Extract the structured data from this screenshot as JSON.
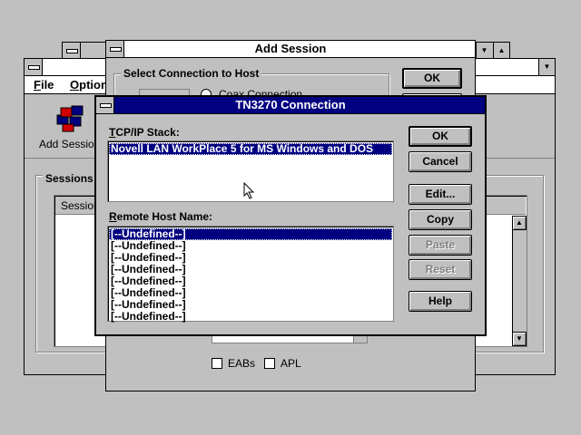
{
  "app_window": {
    "menu": [
      {
        "label": "File",
        "mnemonic": "F",
        "rest": "ile"
      },
      {
        "label": "Option",
        "mnemonic": "O",
        "rest": "ption"
      }
    ],
    "toolbar": {
      "add_session_label": "Add Session"
    },
    "sessions_group_label": "Sessions",
    "sessions_column_header": "Session"
  },
  "add_session_dialog": {
    "title": "Add Session",
    "group_label": "Select Connection to Host",
    "radio_label": "Coax Connection",
    "ok_label": "OK",
    "eabs_label": "EABs",
    "apl_label": "APL"
  },
  "tn3270_dialog": {
    "title": "TN3270 Connection",
    "tcpip_label": "TCP/IP Stack:",
    "tcpip_mnemonic": "T",
    "tcpip_rest": "CP/IP Stack:",
    "tcpip_items": [
      "Novell LAN WorkPlace 5 for MS Windows and DOS"
    ],
    "remote_host_label": "Remote Host Name:",
    "remote_host_mnemonic": "R",
    "remote_host_rest": "emote Host Name:",
    "remote_host_items": [
      "[--Undefined--]",
      "[--Undefined--]",
      "[--Undefined--]",
      "[--Undefined--]",
      "[--Undefined--]",
      "[--Undefined--]",
      "[--Undefined--]",
      "[--Undefined--]"
    ],
    "buttons": {
      "ok": "OK",
      "cancel": "Cancel",
      "edit": "Edit...",
      "copy": "Copy",
      "paste": "Paste",
      "reset": "Reset",
      "help": "Help"
    }
  },
  "colors": {
    "desktop": "#c0c0c0",
    "selection": "#000080",
    "active_caption": "#000080"
  }
}
